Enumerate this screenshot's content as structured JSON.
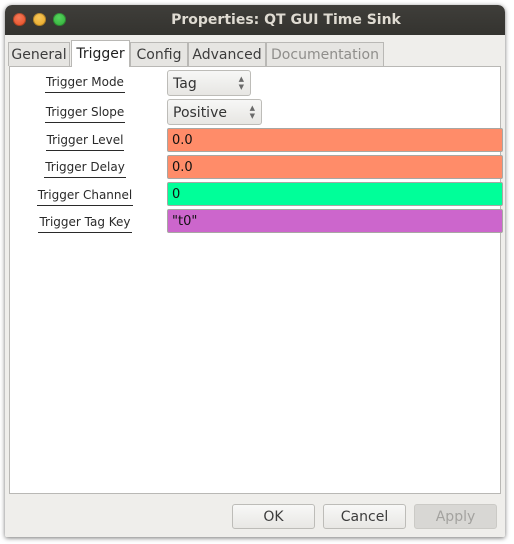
{
  "window": {
    "title": "Properties: QT GUI Time Sink"
  },
  "tabs": [
    {
      "label": "General"
    },
    {
      "label": "Trigger"
    },
    {
      "label": "Config"
    },
    {
      "label": "Advanced"
    },
    {
      "label": "Documentation"
    }
  ],
  "active_tab": "Trigger",
  "params": {
    "trigger_mode": {
      "label": "Trigger Mode",
      "value": "Tag"
    },
    "trigger_slope": {
      "label": "Trigger Slope",
      "value": "Positive"
    },
    "trigger_level": {
      "label": "Trigger Level",
      "value": "0.0"
    },
    "trigger_delay": {
      "label": "Trigger Delay",
      "value": "0.0"
    },
    "trigger_channel": {
      "label": "Trigger Channel",
      "value": "0"
    },
    "trigger_tag_key": {
      "label": "Trigger Tag Key",
      "value": "\"t0\""
    }
  },
  "buttons": {
    "ok": "OK",
    "cancel": "Cancel",
    "apply": "Apply"
  },
  "colors": {
    "float_field": "#ff8c69",
    "int_field": "#00ff99",
    "string_field": "#cc66cc"
  },
  "icons": {
    "combo_arrows": "up-down-arrows-icon"
  }
}
